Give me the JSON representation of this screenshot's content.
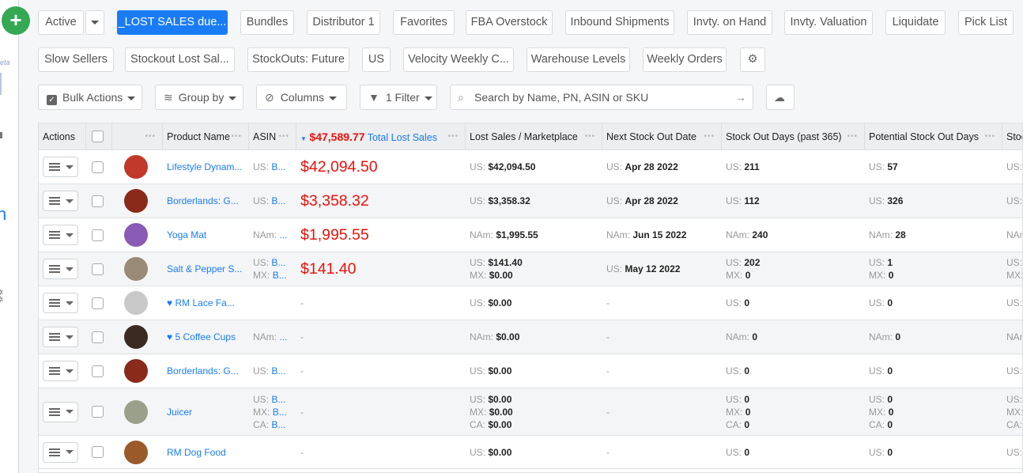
{
  "sidebar": {
    "beta_label": "eta",
    "partial_letter": "n",
    "gear_icon": "gear-icon"
  },
  "add_button": "+",
  "views": [
    "Active",
    "_LOST SALES due...",
    "Bundles",
    "Distributor 1",
    "Favorites",
    "FBA Overstock",
    "Inbound Shipments",
    "Invty. on Hand",
    "Invty. Valuation",
    "Liquidate",
    "Pick List",
    "Slow Sellers",
    "Stockout Lost Sal...",
    "StockOuts: Future",
    "US",
    "Velocity Weekly C...",
    "Warehouse Levels",
    "Weekly Orders"
  ],
  "active_view": "_LOST SALES due...",
  "toolbar": {
    "bulk_actions": "Bulk Actions",
    "group_by": "Group by",
    "columns": "Columns",
    "filter": "1 Filter",
    "search_placeholder": "Search by Name, PN, ASIN or SKU"
  },
  "colors": {
    "accent": "#1a7cf5",
    "lost_sales": "#e8120c",
    "add": "#34a853"
  },
  "table": {
    "headers": {
      "actions": "Actions",
      "product_name": "Product Name",
      "asin": "ASIN",
      "total_amount": "$47,589.77",
      "total_label": "Total Lost Sales",
      "lost_per_marketplace": "Lost Sales / Marketplace",
      "next_stock_out": "Next Stock Out Date",
      "stock_out_days": "Stock Out Days (past 365)",
      "potential_days": "Potential Stock Out Days",
      "next_col": "Stoc"
    },
    "sort": "descending on Total Lost Sales",
    "rows": [
      {
        "name": "Lifestyle Dynam...",
        "fav": false,
        "img": "#c0392b",
        "asin": [
          [
            "US:",
            "B..."
          ]
        ],
        "total": "$42,094.50",
        "lost": [
          [
            "US:",
            "$42,094.50"
          ]
        ],
        "next": [
          [
            "US:",
            "Apr 28 2022"
          ]
        ],
        "sod": [
          [
            "US:",
            "211"
          ]
        ],
        "pot": [
          [
            "US:",
            "57"
          ]
        ],
        "stoc": [
          "US:"
        ]
      },
      {
        "name": "Borderlands: G...",
        "fav": false,
        "img": "#8a2a1a",
        "asin": [
          [
            "US:",
            "B..."
          ]
        ],
        "total": "$3,358.32",
        "lost": [
          [
            "US:",
            "$3,358.32"
          ]
        ],
        "next": [
          [
            "US:",
            "Apr 28 2022"
          ]
        ],
        "sod": [
          [
            "US:",
            "112"
          ]
        ],
        "pot": [
          [
            "US:",
            "326"
          ]
        ],
        "stoc": [
          "US:"
        ]
      },
      {
        "name": "Yoga Mat",
        "fav": false,
        "img": "#8a5bb5",
        "asin": [
          [
            "NAm:",
            "..."
          ]
        ],
        "total": "$1,995.55",
        "lost": [
          [
            "NAm:",
            "$1,995.55"
          ]
        ],
        "next": [
          [
            "NAm:",
            "Jun 15 2022"
          ]
        ],
        "sod": [
          [
            "NAm:",
            "240"
          ]
        ],
        "pot": [
          [
            "NAm:",
            "28"
          ]
        ],
        "stoc": [
          "NAm"
        ]
      },
      {
        "name": "Salt & Pepper S...",
        "fav": false,
        "img": "#9a8a78",
        "asin": [
          [
            "US:",
            "B..."
          ],
          [
            "MX:",
            "B..."
          ]
        ],
        "total": "$141.40",
        "lost": [
          [
            "US:",
            "$141.40"
          ],
          [
            "MX:",
            "$0.00"
          ]
        ],
        "next": [
          [
            "US:",
            "May 12 2022"
          ]
        ],
        "sod": [
          [
            "US:",
            "202"
          ],
          [
            "MX:",
            "0"
          ]
        ],
        "pot": [
          [
            "US:",
            "1"
          ],
          [
            "MX:",
            "0"
          ]
        ],
        "stoc": [
          "US:",
          "MX:"
        ]
      },
      {
        "name": "RM Lace Fa...",
        "fav": true,
        "img": "#c8c8c8",
        "asin": [],
        "total": "-",
        "lost": [
          [
            "US:",
            "$0.00"
          ]
        ],
        "next": "-",
        "sod": [
          [
            "US:",
            "0"
          ]
        ],
        "pot": [
          [
            "US:",
            "0"
          ]
        ],
        "stoc": [
          "US:"
        ]
      },
      {
        "name": "5 Coffee Cups",
        "fav": true,
        "img": "#3a2a20",
        "asin": [
          [
            "NAm:",
            "..."
          ]
        ],
        "total": "-",
        "lost": [
          [
            "NAm:",
            "$0.00"
          ]
        ],
        "next": "-",
        "sod": [
          [
            "NAm:",
            "0"
          ]
        ],
        "pot": [
          [
            "NAm:",
            "0"
          ]
        ],
        "stoc": [
          "NAm"
        ]
      },
      {
        "name": "Borderlands: G...",
        "fav": false,
        "img": "#8a2a1a",
        "asin": [
          [
            "US:",
            "B..."
          ]
        ],
        "total": "-",
        "lost": [
          [
            "US:",
            "$0.00"
          ]
        ],
        "next": "-",
        "sod": [
          [
            "US:",
            "0"
          ]
        ],
        "pot": [
          [
            "US:",
            "0"
          ]
        ],
        "stoc": [
          "US:"
        ]
      },
      {
        "name": "Juicer",
        "fav": false,
        "img": "#9aa08a",
        "asin": [
          [
            "US:",
            "B..."
          ],
          [
            "MX:",
            "B..."
          ],
          [
            "CA:",
            "B..."
          ]
        ],
        "total": "-",
        "lost": [
          [
            "US:",
            "$0.00"
          ],
          [
            "MX:",
            "$0.00"
          ],
          [
            "CA:",
            "$0.00"
          ]
        ],
        "next": "-",
        "sod": [
          [
            "US:",
            "0"
          ],
          [
            "MX:",
            "0"
          ],
          [
            "CA:",
            "0"
          ]
        ],
        "pot": [
          [
            "US:",
            "0"
          ],
          [
            "MX:",
            "0"
          ],
          [
            "CA:",
            "0"
          ]
        ],
        "stoc": [
          "US:",
          "MX:",
          "CA:"
        ]
      },
      {
        "name": "RM Dog Food",
        "fav": false,
        "img": "#9a5a2a",
        "asin": [],
        "total": "-",
        "lost": [
          [
            "US:",
            "$0.00"
          ]
        ],
        "next": "-",
        "sod": [
          [
            "US:",
            "0"
          ]
        ],
        "pot": [
          [
            "US:",
            "0"
          ]
        ],
        "stoc": [
          "US:"
        ]
      }
    ]
  }
}
